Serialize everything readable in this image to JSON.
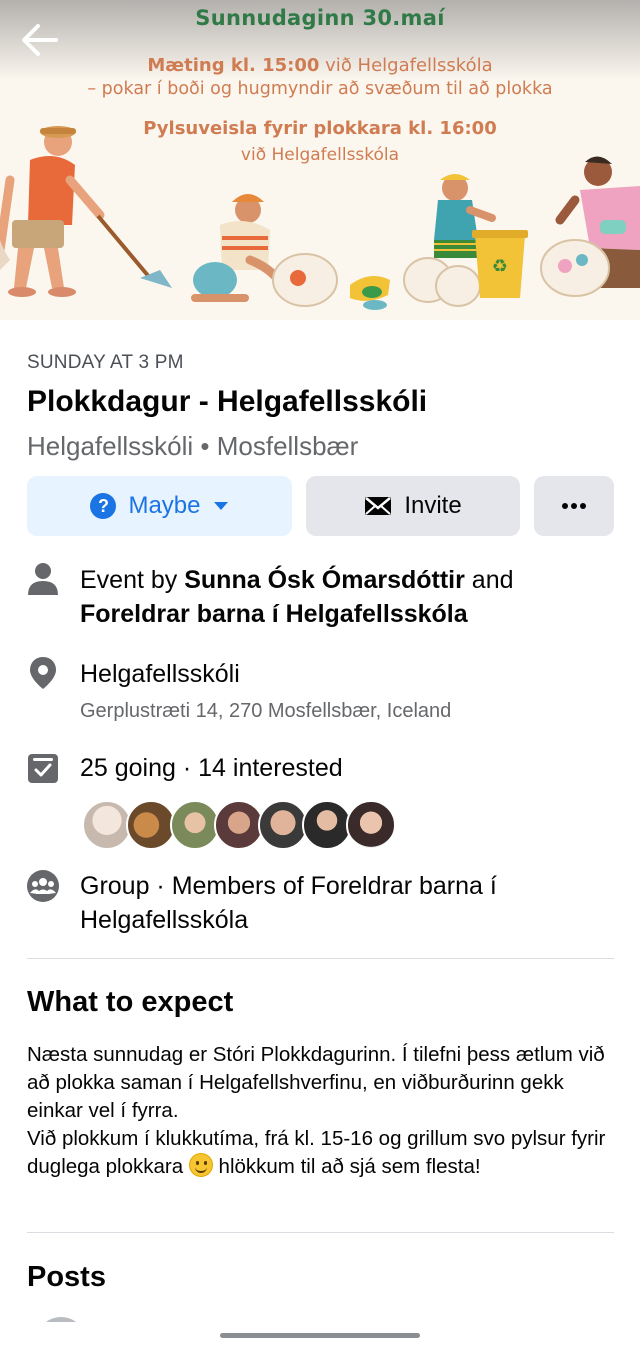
{
  "banner": {
    "date_line": "Sunnudaginn 30.maí",
    "meet_time": "Mæting kl. 15:00",
    "meet_place": " við Helgafellsskóla",
    "bags_line": "– pokar í boði og hugmyndir að svæðum til að plokka",
    "party_line": "Pylsuveisla fyrir plokkara kl. 16:00",
    "party_place": "við Helgafellsskóla"
  },
  "event": {
    "when": "SUNDAY AT 3 PM",
    "title": "Plokkdagur - Helgafellsskóli",
    "subtitle": "Helgafellsskóli • Mosfellsbær"
  },
  "actions": {
    "maybe_label": "Maybe",
    "invite_label": "Invite"
  },
  "host": {
    "prefix": "Event by ",
    "name1": "Sunna Ósk Ómarsdóttir",
    "joiner": " and ",
    "name2": "Foreldrar barna í Helgafellsskóla"
  },
  "location": {
    "name": "Helgafellsskóli",
    "address": "Gerplustræti 14, 270 Mosfellsbær, Iceland"
  },
  "attendance": {
    "text": "25 going · 14 interested"
  },
  "group": {
    "text": "Group · Members of Foreldrar barna í Helgafellsskóla"
  },
  "about": {
    "heading": "What to expect",
    "line1": "Næsta sunnudag er Stóri Plokkdagurinn. Í tilefni þess ætlum við að plokka saman í Helgafellshverfinu, en viðburðurinn gekk einkar vel í fyrra.",
    "line2_before": "Við plokkum í klukkutíma, frá kl. 15-16 og grillum svo pylsur fyrir duglega plokkara ",
    "line2_after": " hlökkum til að sjá sem flesta!"
  },
  "posts": {
    "heading": "Posts"
  },
  "colors": {
    "accent": "#1b74e4",
    "maybe_bg": "#e7f3ff",
    "banner_green": "#2f7a47",
    "banner_orange": "#d07c52"
  }
}
